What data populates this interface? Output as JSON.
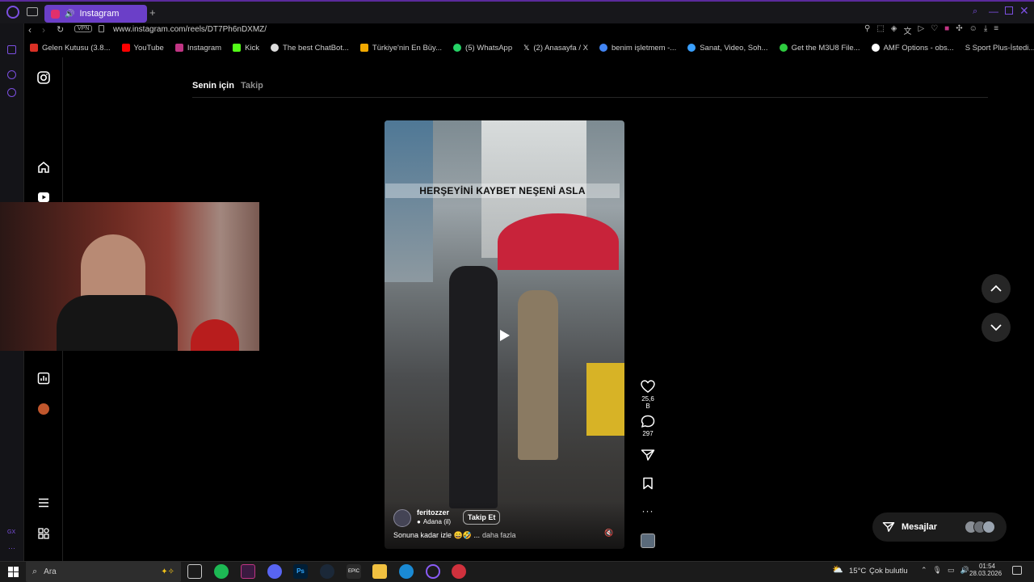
{
  "browser": {
    "tab_title": "Instagram",
    "url": "www.instagram.com/reels/DT7Ph6nDXMZ/",
    "vpn_label": "VPN",
    "bookmarks": [
      {
        "label": "Gelen Kutusu (3.8...",
        "color": "#d93025"
      },
      {
        "label": "YouTube",
        "color": "#ff0000"
      },
      {
        "label": "Instagram",
        "color": "#c13584"
      },
      {
        "label": "Kick",
        "color": "#53fc18"
      },
      {
        "label": "The best ChatBot...",
        "color": "#dddddd"
      },
      {
        "label": "Türkiye'nin En Büy...",
        "color": "#f2a900"
      },
      {
        "label": "(5) WhatsApp",
        "color": "#25d366"
      },
      {
        "label": "(2) Anasayfa / X",
        "color": "#ffffff"
      },
      {
        "label": "benim işletmem -...",
        "color": "#4285f4"
      },
      {
        "label": "Sanat, Video, Soh...",
        "color": "#3aa0ff"
      },
      {
        "label": "Get the M3U8 File...",
        "color": "#2ecc40"
      },
      {
        "label": "AMF Options - obs...",
        "color": "#ffffff"
      },
      {
        "label": "S Sport Plus-İstedi...",
        "color": "#888888"
      }
    ]
  },
  "instagram": {
    "feed_tabs": {
      "for_you": "Senin için",
      "following": "Takip"
    },
    "reel": {
      "overlay_caption": "HERŞEYİNİ KAYBET NEŞENİ ASLA",
      "username": "feritozzer",
      "location": "Adana (il)",
      "follow_label": "Takip Et",
      "description": "Sonuna kadar izle 😄🤣 ...",
      "more_label": "daha fazla",
      "likes": "25,6 B",
      "comments": "297"
    },
    "messages_label": "Mesajlar"
  },
  "taskbar": {
    "search_placeholder": "Ara",
    "weather_temp": "15°C",
    "weather_text": "Çok bulutlu",
    "time": "01:54",
    "date": "28.03.2026"
  },
  "colors": {
    "opera_accent": "#6b3fc8",
    "instagram_bg": "#000000"
  }
}
